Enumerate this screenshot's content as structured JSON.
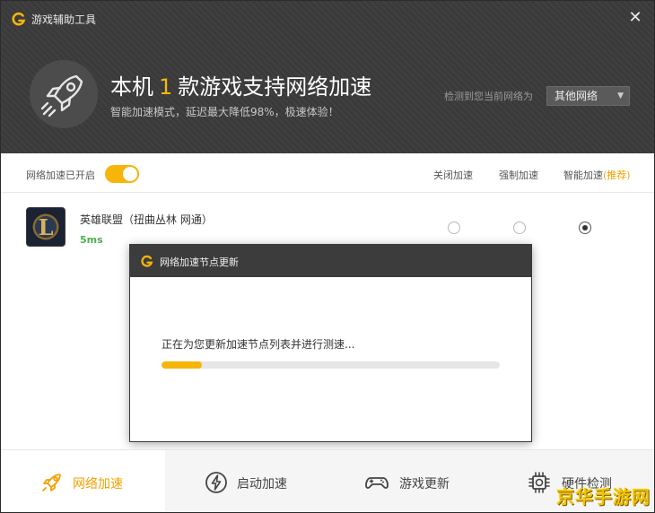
{
  "window": {
    "title": "游戏辅助工具"
  },
  "header": {
    "headline_prefix": "本机",
    "headline_count": "1",
    "headline_suffix": "款游戏支持网络加速",
    "subline": "智能加速模式，延迟最大降低98%，极速体验！",
    "network_label": "检测到您当前网络为",
    "network_value": "其他网络"
  },
  "toolbar": {
    "toggle_label": "网络加速已开启",
    "toggle_on": true,
    "mode_off": "关闭加速",
    "mode_force": "强制加速",
    "mode_smart": "智能加速",
    "mode_smart_tag": "(推荐)"
  },
  "game": {
    "name": "英雄联盟（扭曲丛林 网通）",
    "ping": "5ms",
    "selected_mode": "智能加速"
  },
  "dialog": {
    "title": "网络加速节点更新",
    "message": "正在为您更新加速节点列表并进行测速...",
    "progress_percent": 12
  },
  "footer": {
    "items": [
      {
        "label": "网络加速",
        "icon": "rocket-icon",
        "active": true
      },
      {
        "label": "启动加速",
        "icon": "lightning-icon",
        "active": false
      },
      {
        "label": "游戏更新",
        "icon": "gamepad-icon",
        "active": false
      },
      {
        "label": "硬件检测",
        "icon": "chip-icon",
        "active": false
      }
    ]
  },
  "watermark": "京华手游网",
  "colors": {
    "accent": "#f5b50a",
    "header_bg": "#3a3a3a",
    "ping": "#4caf50"
  }
}
